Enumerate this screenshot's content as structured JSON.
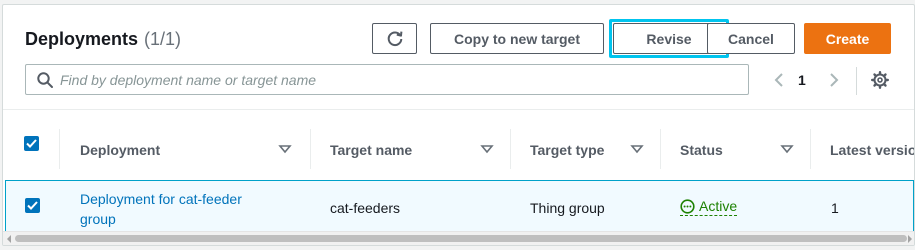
{
  "header": {
    "title": "Deployments",
    "count": "(1/1)"
  },
  "toolbar": {
    "refresh_icon": "refresh-icon",
    "copy_label": "Copy to new target",
    "revise_label": "Revise",
    "cancel_label": "Cancel",
    "create_label": "Create",
    "accent_color": "#ec7211",
    "focus_color": "#00c4ee"
  },
  "search": {
    "value": "",
    "placeholder": "Find by deployment name or target name"
  },
  "pagination": {
    "current_page": "1"
  },
  "table": {
    "columns": [
      {
        "label": "Deployment"
      },
      {
        "label": "Target name"
      },
      {
        "label": "Target type"
      },
      {
        "label": "Status"
      },
      {
        "label": "Latest version"
      }
    ],
    "rows": [
      {
        "selected": true,
        "deployment_line1": "Deployment for cat-feeder",
        "deployment_line2": "group",
        "target_name": "cat-feeders",
        "target_type": "Thing group",
        "status": "Active",
        "latest_version": "1"
      }
    ]
  }
}
